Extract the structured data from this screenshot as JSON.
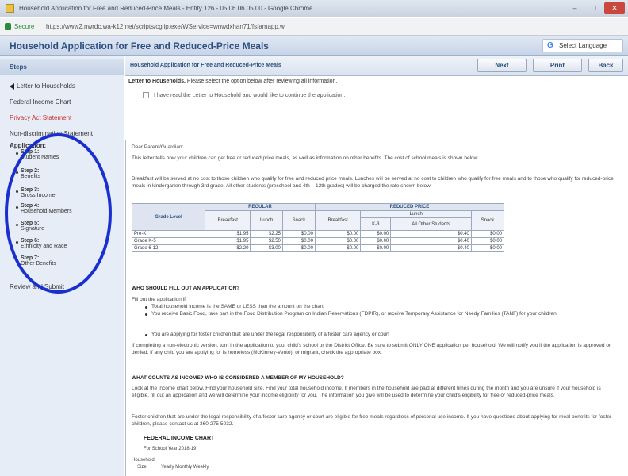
{
  "window": {
    "title": "Household Application for Free and Reduced-Price Meals - Entity 126 - 05.06.06.05.00 - Google Chrome",
    "minimize": "–",
    "maximize": "□",
    "close": "✕"
  },
  "address_bar": {
    "secure_label": "Secure",
    "url": "https://www2.nwrdc.wa-k12.net/scripts/cgiip.exe/WService=wnwdxhan71/fsfamapp.w"
  },
  "header": {
    "app_title": "Household Application for Free and Reduced-Price Meals",
    "language_button": "Select Language"
  },
  "sidebar": {
    "heading": "Steps",
    "items": [
      {
        "label": "Letter to Households"
      },
      {
        "label": "Federal Income Chart"
      },
      {
        "label": "Privacy Act Statement"
      },
      {
        "label": "Non-discrimination Statement"
      },
      {
        "label": "Application:"
      }
    ],
    "steps": [
      {
        "step": "Step 1:",
        "name": "Student Names"
      },
      {
        "step": "Step 2:",
        "name": "Benefits"
      },
      {
        "step": "Step 3:",
        "name": "Gross Income"
      },
      {
        "step": "Step 4:",
        "name": "Household Members"
      },
      {
        "step": "Step 5:",
        "name": "Signature"
      },
      {
        "step": "Step 6:",
        "name": "Ethnicity and Race"
      },
      {
        "step": "Step 7:",
        "name": "Other Benefits"
      }
    ],
    "review": "Review and Submit"
  },
  "content_toolbar": {
    "title": "Household Application for Free and Reduced-Price Meals",
    "next": "Next",
    "print": "Print",
    "back": "Back"
  },
  "instructions": {
    "bold": "Letter to Households.",
    "text": " Please select the option below after reviewing all information.",
    "checkbox_label": "I have read the Letter to Household and would like to continue the application."
  },
  "letter": {
    "greeting": "Dear Parent/Guardian:",
    "p1": "This letter tells how your children can get free or reduced price meals, as well as information on other benefits. The cost of school meals is shown below.",
    "p2": "Breakfast will be served at no cost to those children who qualify for free and reduced price meals. Lunches will be served at no cost to children who qualify for free meals and to those who qualify for reduced-price meals in kindergarten through 3rd grade. All other students (preschool and 4th – 12th grades) will be charged the rate shown below.",
    "table": {
      "grade_header": "Grade Level",
      "regular_header": "REGULAR",
      "reduced_header": "REDUCED PRICE",
      "lunch_group": "Lunch",
      "regular_cols": [
        "Breakfast",
        "Lunch",
        "Snack"
      ],
      "reduced_cols": [
        "Breakfast",
        "K-3",
        "All Other Students",
        "Snack"
      ],
      "rows": [
        {
          "grade": "Pre-K",
          "values": [
            "$1.95",
            "$2.25",
            "$0.00",
            "$0.00",
            "$0.00",
            "$0.40",
            "$0.00"
          ]
        },
        {
          "grade": "Grade K-5",
          "values": [
            "$1.95",
            "$2.50",
            "$0.00",
            "$0.00",
            "$0.00",
            "$0.40",
            "$0.00"
          ]
        },
        {
          "grade": "Grade 6-12",
          "values": [
            "$2.20",
            "$3.00",
            "$0.00",
            "$0.00",
            "$0.00",
            "$0.40",
            "$0.00"
          ]
        }
      ]
    },
    "who_heading": "WHO SHOULD FILL OUT AN APPLICATION?",
    "fill_intro": "Fill out the application if:",
    "bullets": [
      "Total household income is the SAME or LESS than the amount on the chart",
      "You receive Basic Food, take part in the Food Distribution Program on Indian Reservations (FDPIR), or receive Temporary Assistance for Needy Families (TANF) for your children.",
      "You are applying for foster children that are under the legal responsibility of a foster care agency or court"
    ],
    "p3": "If completing a non-electronic version, turn in the application to your child's school or the District Office. Be sure to submit ONLY ONE application per household. We will notify you if the application is approved or denied. If any child you are applying for is homeless (McKinney-Vento), or migrant, check the appropriate box.",
    "income_heading": "WHAT COUNTS AS INCOME? WHO IS CONSIDERED A MEMBER OF MY HOUSEHOLD?",
    "p4": "Look at the income chart below. Find your household size. Find your total household income. If members in the household are paid at different times during the month and you are unsure if your household is eligible, fill out an application and we will determine your income eligibility for you. The information you give will be used to determine your child's eligibility for free or reduced-price meals.",
    "p5": "Foster children that are under the legal responsibility of a foster care agency or court are eligible for free meals regardless of personal use income. If you have questions about applying for meal benefits for foster children, please contact us at 360-275-5032.",
    "chart_title": "FEDERAL INCOME CHART",
    "chart_year": "For School Year 2018-19",
    "chart_col_household": "Household",
    "chart_col_size": "Size",
    "chart_cols": "Yearly   Monthly   Weekly"
  }
}
